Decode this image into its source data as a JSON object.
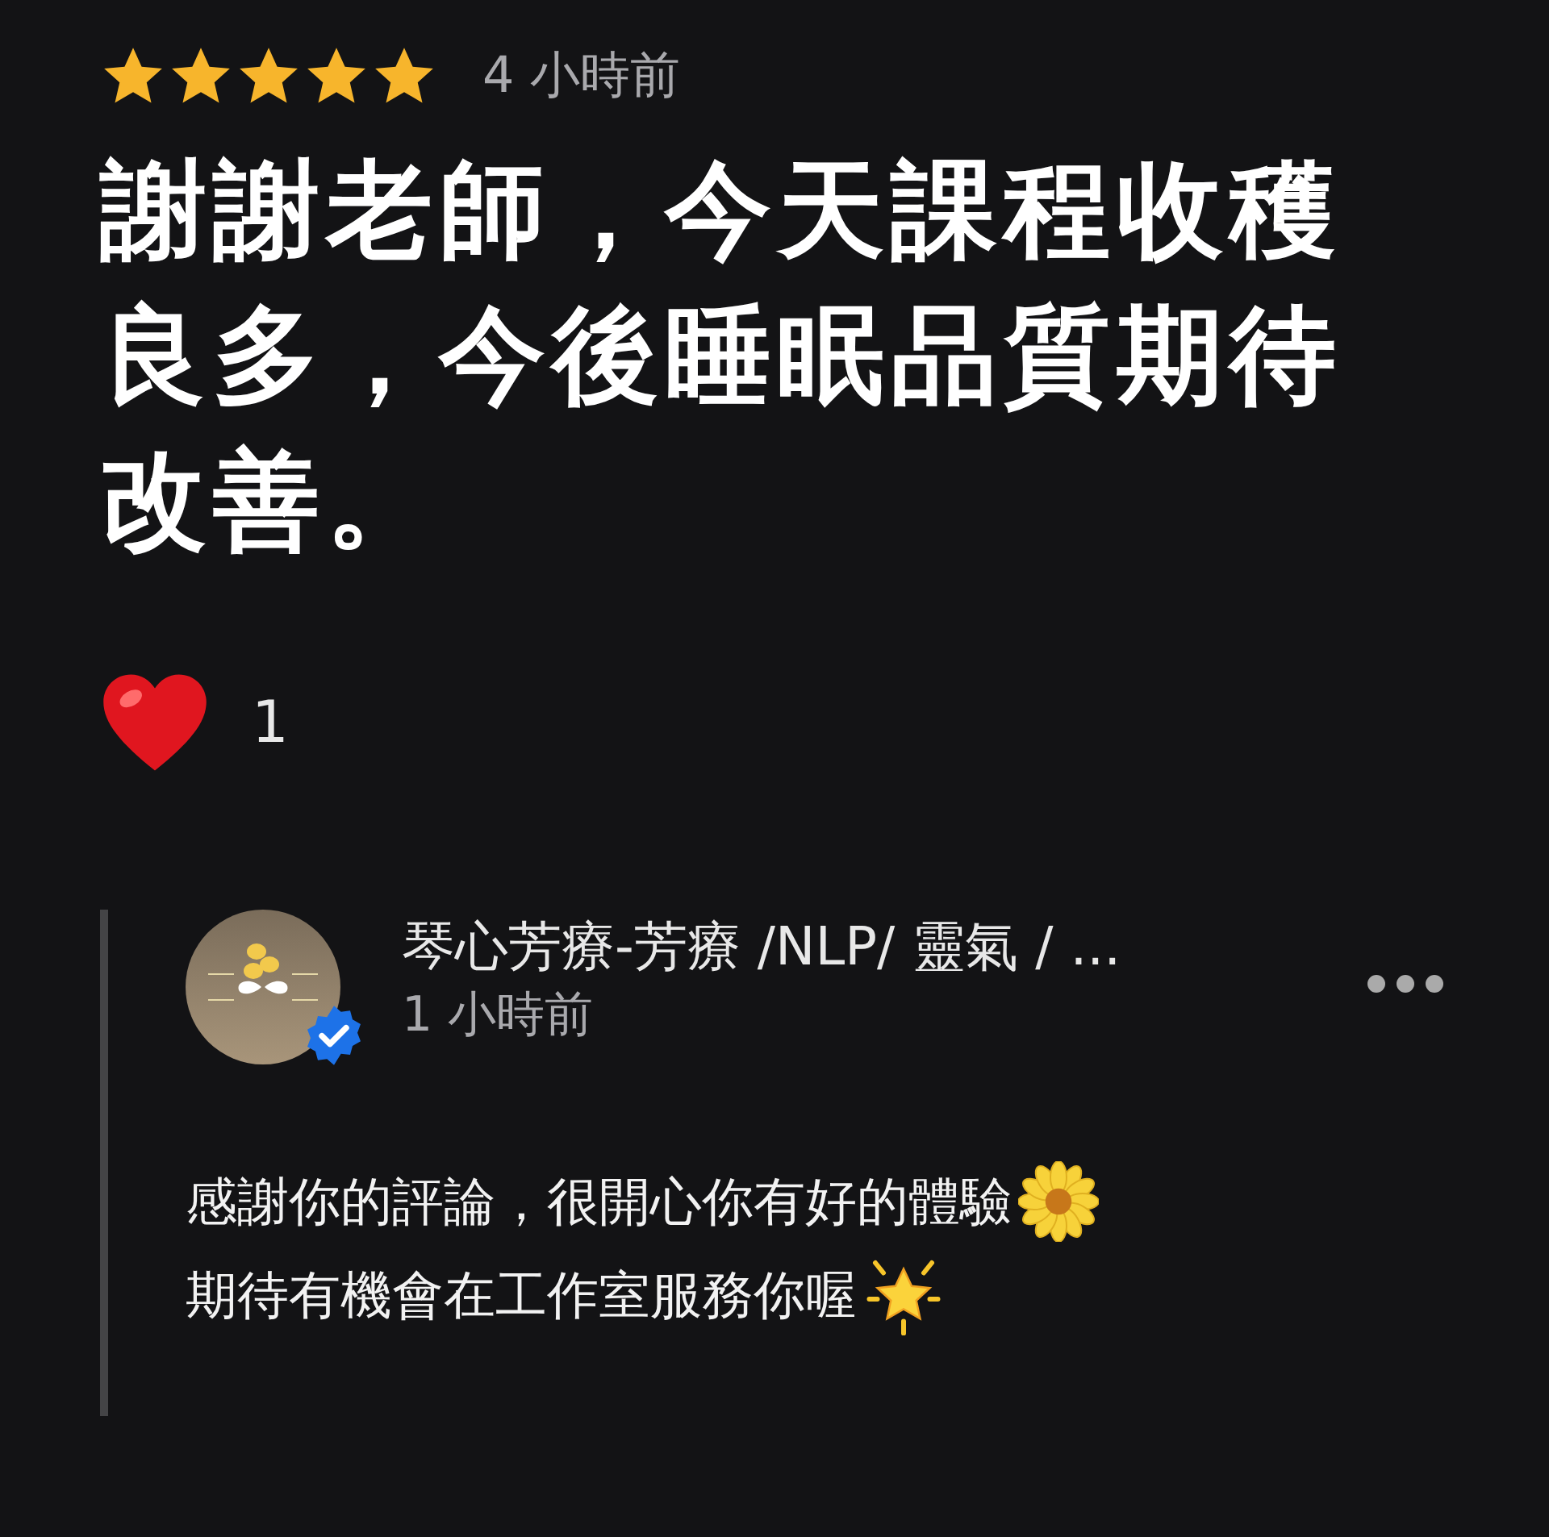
{
  "review": {
    "stars": 5,
    "time": "4 小時前",
    "text": "謝謝老師，今天課程收穫良多，今後睡眠品質期待改善。",
    "reactions": {
      "count": "1"
    }
  },
  "reply": {
    "author": "琴心芳療-芳療 /NLP/ 靈氣 / ...",
    "verified": true,
    "time": "1 小時前",
    "lines": [
      {
        "text": "感謝你的評論，很開心你有好的體驗",
        "kind": "flower"
      },
      {
        "text": "期待有機會在工作室服務你喔",
        "kind": "sparkle_star"
      }
    ]
  }
}
